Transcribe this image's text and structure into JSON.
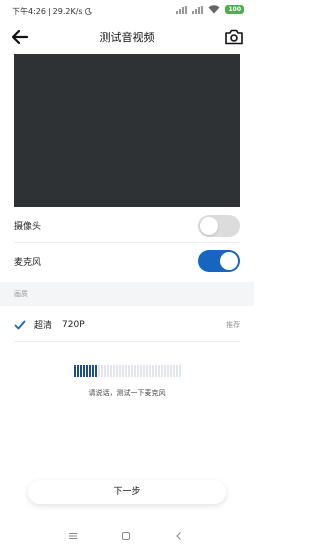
{
  "status_bar": {
    "time": "下午4:26",
    "separator": "|",
    "network_speed": "29.2K/s",
    "battery": "100"
  },
  "header": {
    "title": "测试音视频",
    "back_icon": "arrow-left-icon",
    "right_icon": "camera-switch-icon"
  },
  "settings": {
    "camera_label": "摄像头",
    "camera_on": false,
    "mic_label": "麦克风",
    "mic_on": true,
    "toggle_on_color": "#1665c0",
    "toggle_off_color": "#dcdcdc"
  },
  "quality": {
    "section_title": "画质",
    "option_name": "超清",
    "option_resolution": "720P",
    "option_tag": "推荐",
    "selected": true
  },
  "mic_test": {
    "level_fraction": 0.23,
    "hint": "请说话，测试一下麦克风"
  },
  "footer": {
    "next_label": "下一步"
  },
  "colors": {
    "accent": "#1665c0",
    "preview_bg": "#2f3234",
    "meter_active": "#1f4f8a",
    "meter_inactive": "#e2e6ec"
  }
}
